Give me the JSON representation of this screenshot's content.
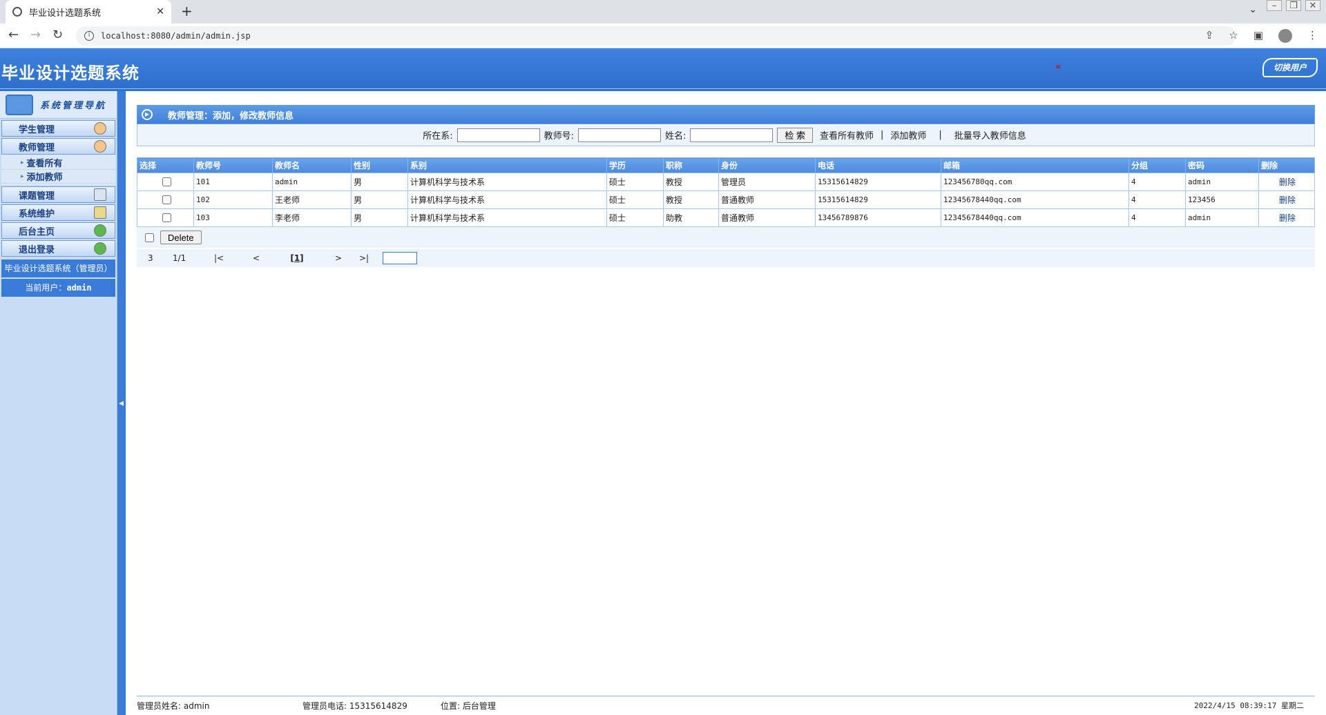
{
  "browser": {
    "tab_title": "毕业设计选题系统",
    "url": "localhost:8080/admin/admin.jsp"
  },
  "header": {
    "app_title": "毕业设计选题系统",
    "switch_user": "切换用户",
    "red_mark": "≡"
  },
  "sidebar": {
    "nav_title": "系统管理导航",
    "items": [
      {
        "label": "学生管理"
      },
      {
        "label": "教师管理"
      }
    ],
    "sub_items": [
      {
        "label": "查看所有"
      },
      {
        "label": "添加教师"
      }
    ],
    "items2": [
      {
        "label": "课题管理"
      },
      {
        "label": "系统维护"
      },
      {
        "label": "后台主页"
      },
      {
        "label": "退出登录"
      }
    ],
    "system_info": "毕业设计选题系统（管理员）",
    "current_user_label": "当前用户：",
    "current_user": "admin"
  },
  "panel": {
    "title": "教师管理：添加，修改教师信息"
  },
  "search": {
    "dept_label": "所在系:",
    "teacher_no_label": "教师号:",
    "name_label": "姓名:",
    "search_button": "检 索",
    "view_all": "查看所有教师",
    "sep": "|",
    "add_teacher": "添加教师",
    "sep2": "|",
    "batch_import": "批量导入教师信息"
  },
  "table": {
    "columns": [
      "选择",
      "教师号",
      "教师名",
      "性别",
      "系别",
      "学历",
      "职称",
      "身份",
      "电话",
      "邮箱",
      "分组",
      "密码",
      "删除"
    ],
    "rows": [
      {
        "no": "101",
        "name": "admin",
        "sex": "男",
        "dept": "计算机科学与技术系",
        "edu": "硕士",
        "title": "教授",
        "role": "管理员",
        "phone": "15315614829",
        "email": "123456780qq.com",
        "group": "4",
        "pwd": "admin",
        "del": "删除"
      },
      {
        "no": "102",
        "name": "王老师",
        "sex": "男",
        "dept": "计算机科学与技术系",
        "edu": "硕士",
        "title": "教授",
        "role": "普通教师",
        "phone": "15315614829",
        "email": "12345678440qq.com",
        "group": "4",
        "pwd": "123456",
        "del": "删除"
      },
      {
        "no": "103",
        "name": "李老师",
        "sex": "男",
        "dept": "计算机科学与技术系",
        "edu": "硕士",
        "title": "助教",
        "role": "普通教师",
        "phone": "13456789876",
        "email": "12345678440qq.com",
        "group": "4",
        "pwd": "admin",
        "del": "删除"
      }
    ]
  },
  "actions": {
    "delete_button": "Delete"
  },
  "pager": {
    "count": "3",
    "pages": "1/1",
    "first": "|<",
    "prev": "<",
    "current": "[1]",
    "next": ">",
    "last": ">|"
  },
  "footer": {
    "admin_name": "管理员姓名: admin",
    "admin_phone": "管理员电话: 15315614829",
    "location": "位置: 后台管理",
    "datetime": "2022/4/15 08:39:17 星期二"
  }
}
